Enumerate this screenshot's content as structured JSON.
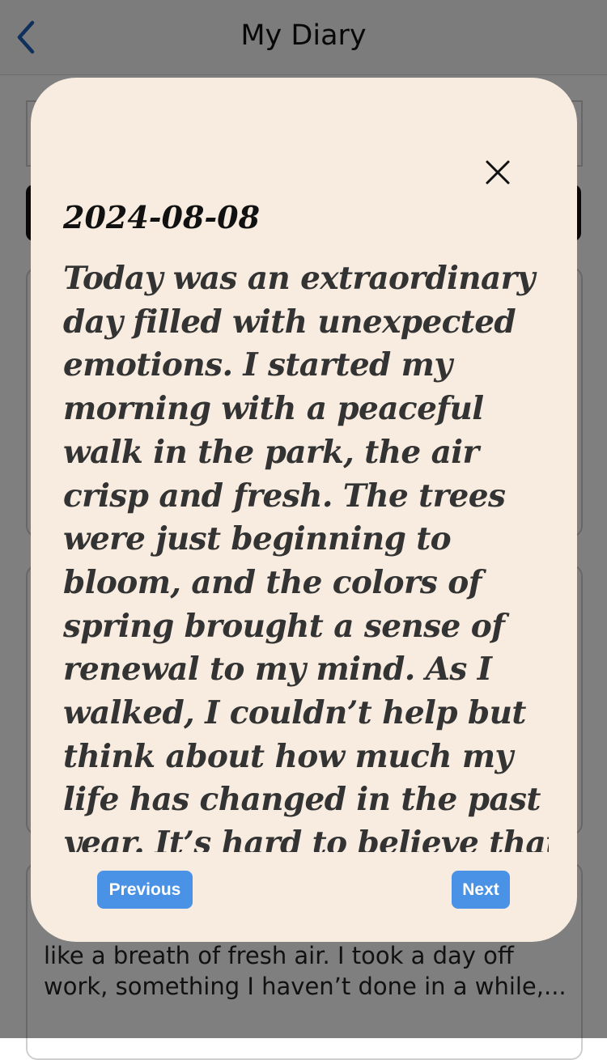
{
  "header": {
    "title": "My Diary",
    "back_icon": "chevron-left-icon"
  },
  "background": {
    "preview_lines": [
      "like a breath of fresh air. I took a day off",
      "work, something I haven’t done in a while,..."
    ]
  },
  "modal": {
    "close_icon": "close-icon",
    "date": "2024-08-08",
    "body_lines": [
      "Today was an extraordinary",
      "day filled with unexpected",
      "emotions. I started my",
      "morning with a peaceful",
      "walk in the park, the air",
      "crisp and fresh. The trees",
      "were just beginning to",
      "bloom, and the colors of",
      "spring brought a sense of",
      "renewal to my mind. As I",
      "walked, I couldn’t help but",
      "think about how much my",
      "life has changed in the past",
      "year. It’s hard to believe that"
    ],
    "prev_label": "Previous",
    "next_label": "Next"
  },
  "colors": {
    "modal_bg": "#f7ecdf",
    "button_bg": "#4a92e6",
    "back_icon": "#1f5fb8"
  }
}
